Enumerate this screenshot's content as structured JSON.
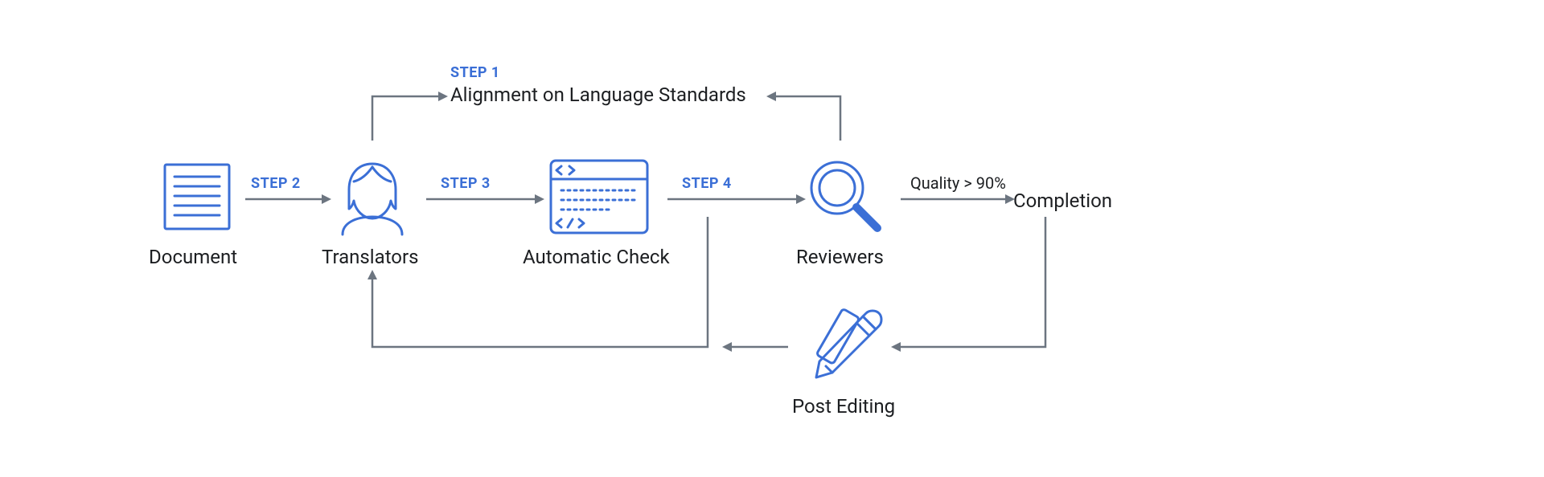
{
  "diagram": {
    "nodes": {
      "document": "Document",
      "translators": "Translators",
      "auto_check": "Automatic Check",
      "reviewers": "Reviewers",
      "completion": "Completion",
      "post_editing": "Post Editing",
      "step1_title": "Alignment on Language Standards"
    },
    "steps": {
      "s1": "STEP 1",
      "s2": "STEP 2",
      "s3": "STEP 3",
      "s4": "STEP 4"
    },
    "conditions": {
      "quality": "Quality > 90%"
    },
    "colors": {
      "accent": "#3b6fd6",
      "arrow": "#6c7580",
      "text": "#1c1e21"
    }
  }
}
